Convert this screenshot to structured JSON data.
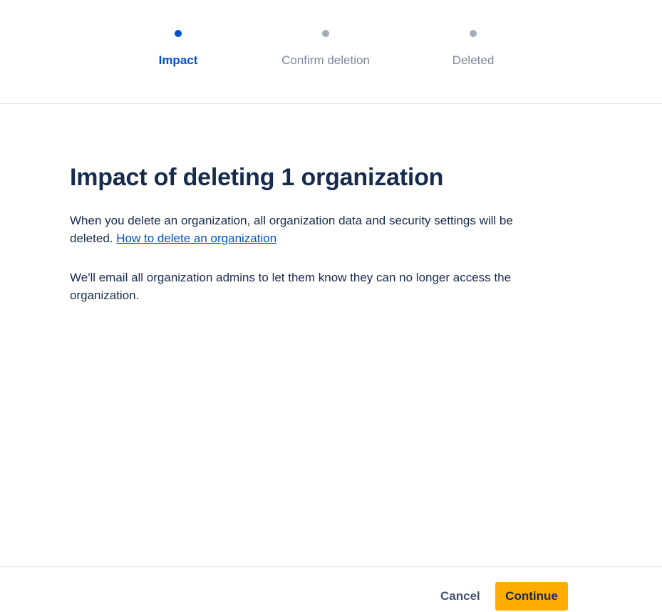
{
  "progress": {
    "steps": [
      {
        "label": "Impact",
        "state": "current"
      },
      {
        "label": "Confirm deletion",
        "state": "upcoming"
      },
      {
        "label": "Deleted",
        "state": "upcoming"
      }
    ]
  },
  "main": {
    "title": "Impact of deleting 1 organization",
    "paragraph1_text": "When you delete an organization, all organization data and security settings will be deleted.",
    "paragraph1_link": "How to delete an organization",
    "paragraph2": "We'll email all organization admins to let them know they can no longer access the organization."
  },
  "footer": {
    "cancel_label": "Cancel",
    "continue_label": "Continue"
  },
  "colors": {
    "accent_blue": "#0052CC",
    "inactive_gray": "#A5ADBA",
    "primary_button": "#FFAB00",
    "text_dark": "#172B4D"
  }
}
